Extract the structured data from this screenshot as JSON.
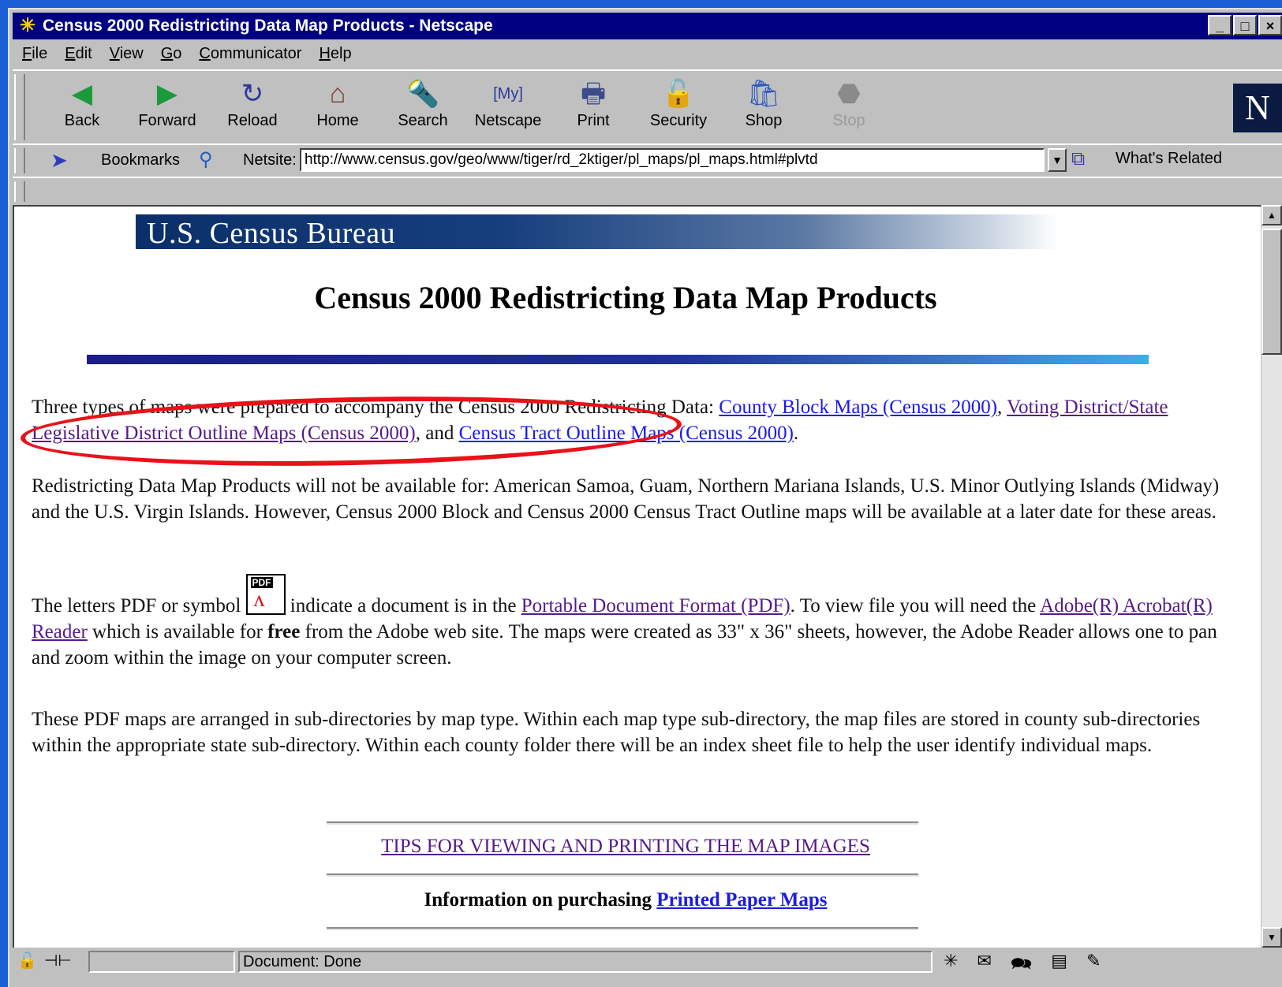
{
  "window": {
    "title": "Census 2000 Redistricting Data Map Products - Netscape",
    "app_icon": "netscape-star-icon",
    "controls": [
      "_",
      "□",
      "×"
    ]
  },
  "menu": [
    {
      "u": "F",
      "rest": "ile"
    },
    {
      "u": "E",
      "rest": "dit"
    },
    {
      "u": "V",
      "rest": "iew"
    },
    {
      "u": "G",
      "rest": "o"
    },
    {
      "u": "C",
      "rest": "ommunicator"
    },
    {
      "u": "H",
      "rest": "elp"
    }
  ],
  "toolbar": {
    "back": "Back",
    "forward": "Forward",
    "reload": "Reload",
    "home": "Home",
    "search": "Search",
    "netscape": "Netscape",
    "print": "Print",
    "security": "Security",
    "shop": "Shop",
    "stop": "Stop",
    "logo": "N"
  },
  "location": {
    "bookmarks": "Bookmarks",
    "netsite_label": "Netsite:",
    "url": "http://www.census.gov/geo/www/tiger/rd_2ktiger/pl_maps/pl_maps.html#plvtd",
    "whats_related": "What's Related"
  },
  "page": {
    "banner": "U.S. Census Bureau",
    "title": "Census 2000 Redistricting Data Map Products",
    "p1_text1": "Three types of maps were prepared to accompany the Census 2000 Redistricting Data:  ",
    "p1_link1": "County Block Maps (Census 2000)",
    "p1_text2": ", ",
    "p1_link2": "Voting District/State Legislative District Outline Maps (Census 2000)",
    "p1_text3": ", and ",
    "p1_link3": "Census Tract Outline Maps (Census 2000)",
    "p1_text4": ".",
    "p2": "Redistricting Data Map Products will not be available for:  American Samoa, Guam, Northern Mariana Islands, U.S. Minor Outlying Islands (Midway) and the U.S. Virgin Islands. However, Census 2000 Block and Census 2000 Census Tract Outline maps will be available at a later date for these areas.",
    "p3_text1": "The letters PDF or symbol ",
    "pdf_icon_label": "PDF",
    "p3_text2": " indicate a document is in the ",
    "p3_link1": "Portable Document Format (PDF)",
    "p3_text3": ". To view file you will need the ",
    "p3_link2": "Adobe(R) Acrobat(R) Reader",
    "p3_text4": " which is available for ",
    "p3_bold": "free",
    "p3_text5": " from the Adobe web site.   The maps were created as 33\" x 36\" sheets, however, the Adobe Reader allows one to pan and zoom within the image on your computer screen.",
    "p4": "These PDF maps are arranged in sub-directories by map type. Within each map type sub-directory, the map files are stored in county sub-directories within the appropriate state sub-directory. Within each county folder there will be an index sheet file to help the user identify individual maps.",
    "tips_link": "TIPS FOR VIEWING AND PRINTING THE MAP IMAGES",
    "purchase_text": "Information on purchasing ",
    "purchase_link": "Printed Paper Maps"
  },
  "status": {
    "text": "Document: Done"
  },
  "colors": {
    "titlebar": "#000080",
    "chrome": "#c0c0c0",
    "link": "#1a1aee",
    "visited_link": "#551a8b",
    "annotation": "#e81218",
    "desktop": "#1a5fd6"
  }
}
